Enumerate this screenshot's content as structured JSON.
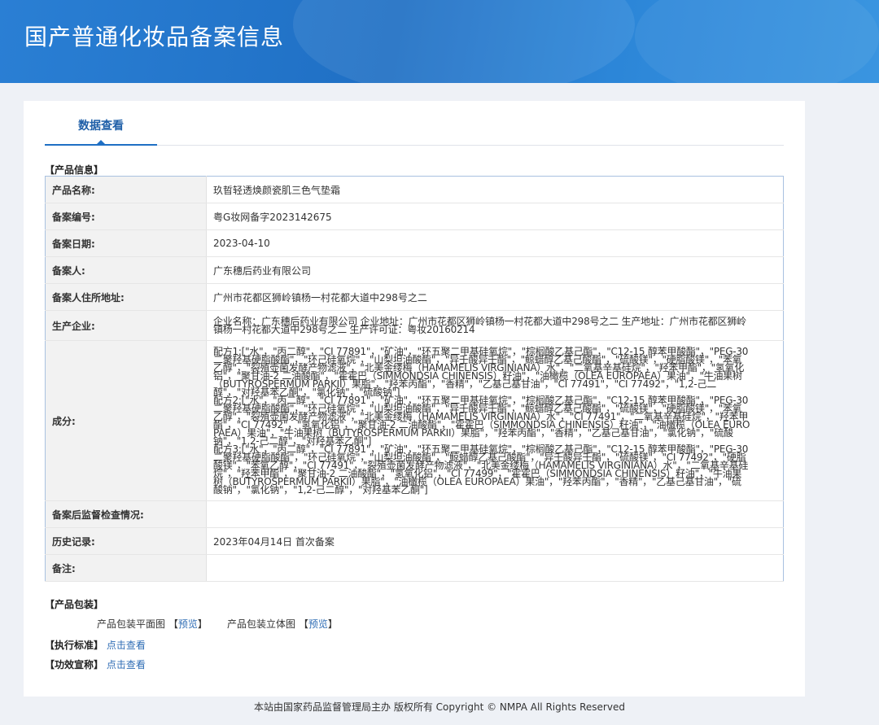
{
  "header": {
    "title": "国产普通化妆品备案信息"
  },
  "tabs": [
    {
      "label": "数据查看"
    }
  ],
  "sections": {
    "product_info": "【产品信息】",
    "product_package": "【产品包装】",
    "standard": "【执行标准】",
    "efficacy": "【功效宣称】"
  },
  "product": {
    "name_label": "产品名称:",
    "name": "玖晢轻透焕颜瓷肌三色气垫霜",
    "reg_no_label": "备案编号:",
    "reg_no": "粤G妆网备字2023142675",
    "date_label": "备案日期:",
    "date": "2023-04-10",
    "filer_label": "备案人:",
    "filer": "广东穗后药业有限公司",
    "address_label": "备案人住所地址:",
    "address": "广州市花都区狮岭镇杨一村花都大道中298号之二",
    "manufacturer_label": "生产企业:",
    "manufacturer": "企业名称：广东穗后药业有限公司 企业地址：广州市花都区狮岭镇杨一村花都大道中298号之二 生产地址：广州市花都区狮岭镇杨一村花都大道中298号之二 生产许可证：粤妆20160214",
    "ingredients_label": "成分:",
    "ingredients": [
      "配方1:[\"水\"，\"丙二醇\"，\"CI 77891\"，\"矿油\"，\"环五聚二甲基硅氧烷\"，\"棕榈酸乙基己酯\"，\"C12-15 醇苯甲酸酯\"，\"PEG-30 二聚羟基硬脂酸酯\"，\"环己硅氧烷\"，\"山梨坦油酸酯\"，\"异壬酸异壬酯\"，\"鲸蜡醇乙基己酸酯\"，\"硫酸镁\"，\"硬脂酸镁\"，\"苯氧乙醇\"，\"裂殖壶菌发酵产物滤液\"，\"北美金缕梅（HAMAMELIS VIRGINIANA）水\"，\"二氧基辛基硅烷\"，\"羟苯甲酯\"，\"氢氧化铝\"，\"聚甘油-2 二油酸酯\"，\"霍霍巴（SIMMONDSIA CHINENSIS）籽油\"，\"油橄榄（OLEA EUROPAEA）果油\"，\"牛油果树（BUTYROSPERMUM PARKII）果脂\"，\"羟苯丙酯\"，\"香精\"，\"乙基己基甘油\"，\"CI 77491\"，\"CI 77492\"，\"1,2-己二醇\"，\"对羟基苯乙酮\"，\"氯化钠\"，\"硫酸钠\"]",
      "配方2:[\"水\"，\"丙二醇\"，\"CI 77891\"，\"矿油\"，\"环五聚二甲基硅氧烷\"，\"棕榈酸乙基己酯\"，\"C12-15 醇苯甲酸酯\"，\"PEG-30 二聚羟基硬脂酸酯\"，\"环己硅氧烷\"，\"山梨坦油酸酯\"，\"异壬酸异壬酯\"，\"鲸蜡醇乙基己酸酯\"，\"硫酸镁\"，\"硬脂酸镁\"，\"苯氧乙醇\"，\"裂殖壶菌发酵产物滤液\"，\"北美金缕梅（HAMAMELIS VIRGINIANA）水\"，\"CI 77491\"，\"二氧基辛基硅烷\"，\"羟苯甲酯\"，\"CI 77492\"，\"氢氧化铝\"，\"聚甘油-2 二油酸酯\"，\"霍霍巴（SIMMONDSIA CHINENSIS）籽油\"，\"油橄榄（OLEA EUROPAEA）果油\"，\"牛油果树（BUTYROSPERMUM PARKII）果脂\"，\"羟苯丙酯\"，\"香精\"，\"乙基己基甘油\"，\"氯化钠\"，\"硫酸钠\"，\"1,2-己二醇\"，\"对羟基苯乙酮\"]",
      "配方3:[\"水\"，\"丙二醇\"，\"CI 77891\"，\"矿油\"，\"环五聚二甲基硅氧烷\"，\"棕榈酸乙基己酯\"，\"C12-15 醇苯甲酸酯\"，\"PEG-30 二聚羟基硬脂酸酯\"，\"环己硅氧烷\"，\"山梨坦油酸酯\"，\"鲸蜡醇乙基己酸酯\"，\"异壬酸异壬酯\"，\"硫酸镁\"，\"CI 77492\"，\"硬脂酸镁\"，\"苯氧乙醇\"，\"CI 77491\"，\"裂殖壶菌发酵产物滤液\"，\"北美金缕梅（HAMAMELIS VIRGINIANA）水\"，\"二氧基辛基硅烷\"，\"羟苯甲酯\"，\"聚甘油-2 二油酸酯\"，\"氢氧化铝\"，\"CI 77499\"，\"霍霍巴（SIMMONDSIA CHINENSIS）籽油\"，\"牛油果树（BUTYROSPERMUM PARKII）果脂\"，\"油橄榄（OLEA EUROPAEA）果油\"，\"羟苯丙酯\"，\"香精\"，\"乙基己基甘油\"，\"硫酸钠\"，\"氯化钠\"，\"1,2-己二醇\"，\"对羟基苯乙酮\"]"
    ],
    "inspection_label": "备案后监督检查情况:",
    "inspection": "",
    "history_label": "历史记录:",
    "history": "2023年04月14日 首次备案",
    "notes_label": "备注:",
    "notes": ""
  },
  "package": {
    "flat_label": "产品包装平面图",
    "flat_link": "预览",
    "solid_label": "产品包装立体图",
    "solid_link": "预览",
    "bracket_open": "【",
    "bracket_close": "】"
  },
  "links": {
    "view": "点击查看"
  },
  "footer": {
    "text": "本站由国家药品监督管理局主办 版权所有 Copyright © NMPA All Rights Reserved"
  }
}
